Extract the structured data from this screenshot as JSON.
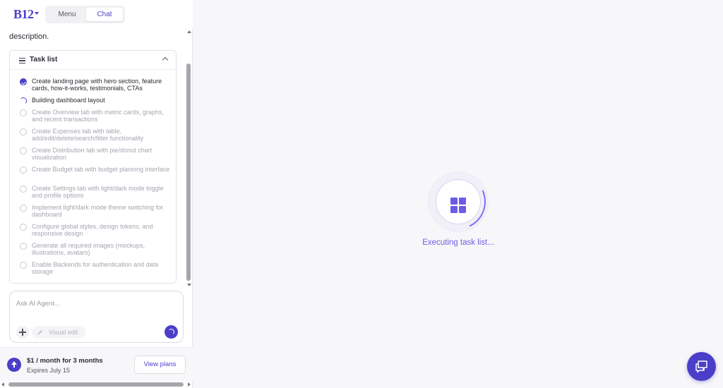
{
  "header": {
    "logo_text": "B12",
    "tabs": [
      {
        "label": "Menu",
        "active": false
      },
      {
        "label": "Chat",
        "active": true
      }
    ]
  },
  "chat": {
    "partial_description": "description."
  },
  "task_list": {
    "title": "Task list",
    "items": [
      {
        "label": "Create landing page with hero section, feature cards, how-it-works, testimonials, CTAs",
        "status": "done"
      },
      {
        "label": "Building dashboard layout",
        "status": "in-progress"
      },
      {
        "label": "Create Overview tab with metric cards, graphs, and recent transactions",
        "status": "pending"
      },
      {
        "label": "Create Expenses tab with table, add/edit/delete/search/filter functionality",
        "status": "pending"
      },
      {
        "label": "Create Distribution tab with pie/donut chart visualization",
        "status": "pending"
      },
      {
        "label": "Create Budget tab with budget planning interface",
        "status": "pending"
      },
      {
        "label": "Create Settings tab with light/dark mode toggle and profile options",
        "status": "pending"
      },
      {
        "label": "Implement light/dark mode theme switching for dashboard",
        "status": "pending"
      },
      {
        "label": "Configure global styles, design tokens, and responsive design",
        "status": "pending"
      },
      {
        "label": "Generate all required images (mockups, illustrations, avatars)",
        "status": "pending"
      },
      {
        "label": "Enable Backends for authentication and data storage",
        "status": "pending"
      }
    ]
  },
  "composer": {
    "placeholder": "Ask AI Agent...",
    "value": "",
    "visual_edit_label": "Visual edit",
    "icons": {
      "add": "plus-icon",
      "visual_edit": "pencil-icon",
      "send": "spinner-icon"
    }
  },
  "plan": {
    "title": "$1 / month for 3 months",
    "subtitle": "Expires July 15",
    "button_label": "View plans",
    "icon": "upload-arrow-icon"
  },
  "main": {
    "status_text": "Executing task list...",
    "loader_icon": "grid-icon"
  },
  "fab": {
    "icon": "chat-bubbles-icon"
  },
  "colors": {
    "accent": "#4b3fc9",
    "accent_light": "#6b5ce7",
    "pending_text": "#a5a5b0",
    "background": "#f7f7f9"
  }
}
